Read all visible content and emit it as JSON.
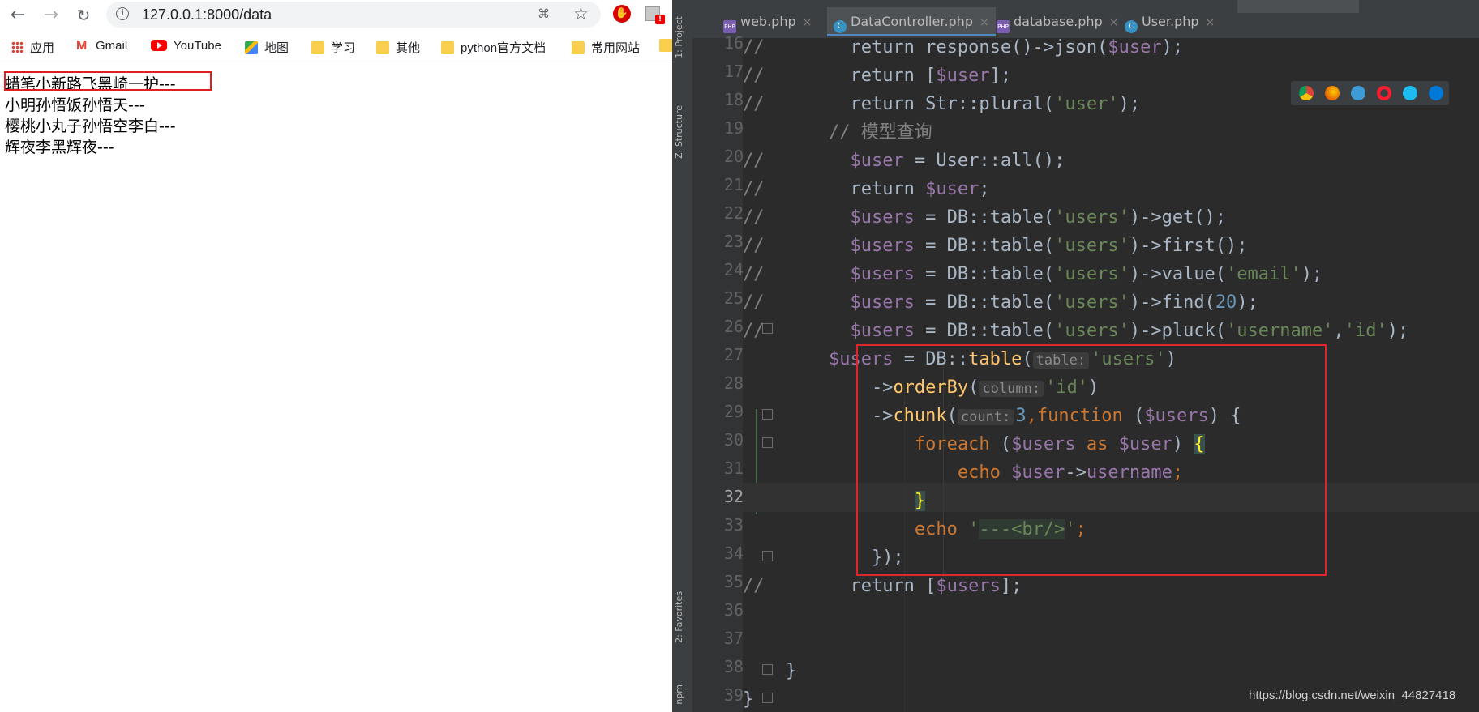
{
  "browser": {
    "url": "127.0.0.1:8000/data",
    "bookmarks": [
      "应用",
      "Gmail",
      "YouTube",
      "地图",
      "学习",
      "其他",
      "python官方文档",
      "常用网站"
    ],
    "page_lines": [
      "蜡笔小新路飞黑崎一护---",
      "小明孙悟饭孙悟天---",
      "樱桃小丸子孙悟空李白---",
      "辉夜李黑辉夜---"
    ],
    "ext_badge": "!"
  },
  "ide": {
    "side_tabs": [
      "1: Project",
      "Z: Structure",
      "2: Favorites",
      "npm"
    ],
    "tabs": [
      {
        "label": "web.php",
        "icon": "php-file-icon"
      },
      {
        "label": "DataController.php",
        "icon": "php-class-icon",
        "active": true
      },
      {
        "label": "database.php",
        "icon": "php-file-icon"
      },
      {
        "label": "User.php",
        "icon": "php-class-icon"
      }
    ],
    "line_numbers": [
      "16",
      "17",
      "18",
      "19",
      "20",
      "21",
      "22",
      "23",
      "24",
      "25",
      "26",
      "27",
      "28",
      "29",
      "30",
      "31",
      "32",
      "33",
      "34",
      "35",
      "36",
      "37",
      "38",
      "39"
    ],
    "current_line": "32",
    "hints": {
      "table": "table:",
      "column": "column:",
      "count": "count:"
    }
  },
  "watermark": "https://blog.csdn.net/weixin_44827418",
  "colors": {
    "highlight_box": "#e02020",
    "editor_bg": "#2b2b2b",
    "accent_tab": "#4a88c7"
  }
}
